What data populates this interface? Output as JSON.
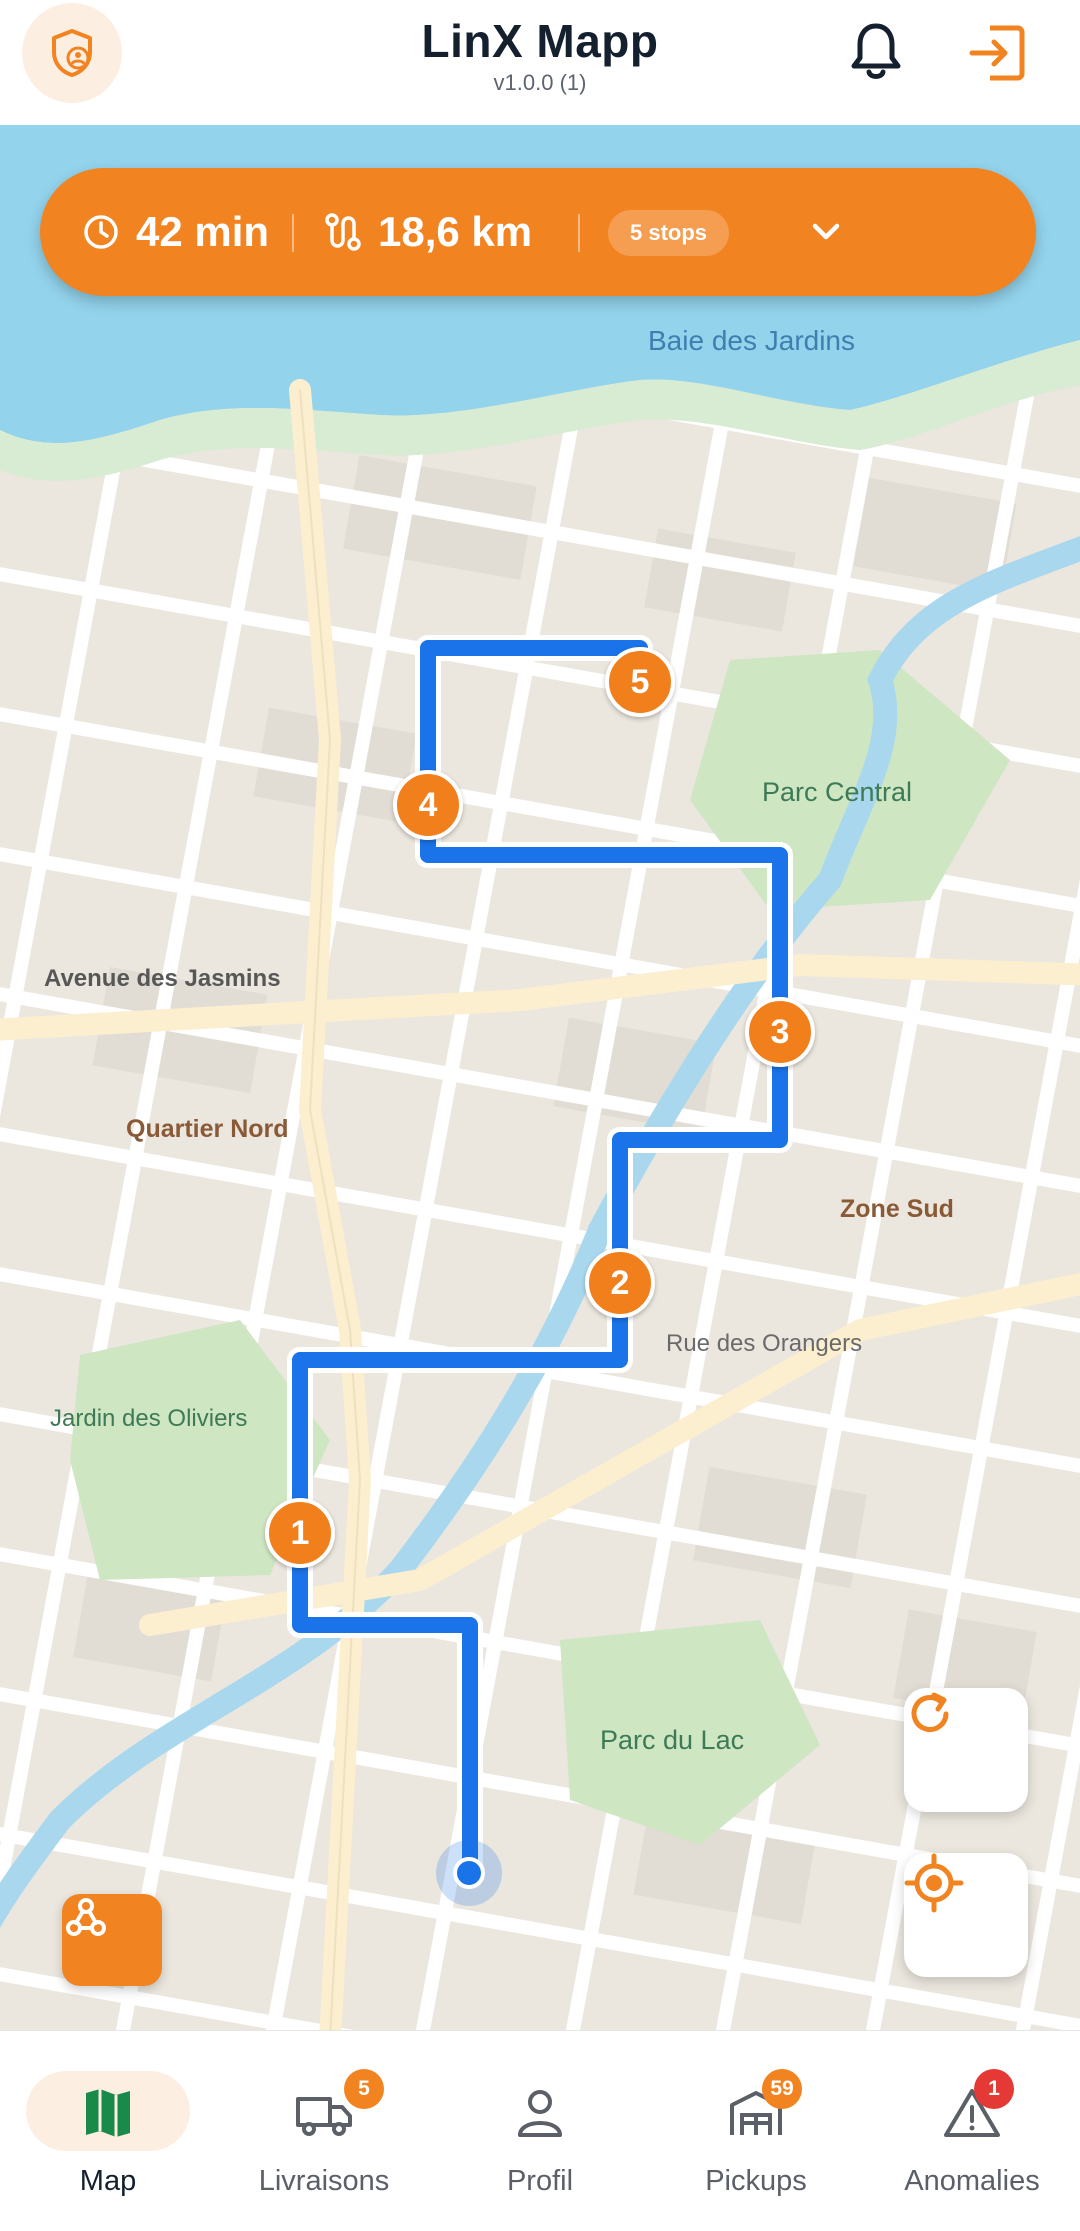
{
  "header": {
    "title": "LinX Mapp",
    "version": "v1.0.0 (1)",
    "left_icon": "shield-user-icon",
    "notification_icon": "bell-icon",
    "logout_icon": "logout-icon"
  },
  "route_summary": {
    "duration": "42 min",
    "distance": "18,6 km",
    "stops": "5 stops"
  },
  "map": {
    "labels": {
      "bay": "Baie des Jardins",
      "park_central": "Parc Central",
      "avenue_jasmins": "Avenue des Jasmins",
      "quartier_nord": "Quartier Nord",
      "zone_sud": "Zone Sud",
      "rue_orangers": "Rue des Orangers",
      "jardin_oliviers": "Jardin des Oliviers",
      "parc_lac": "Parc du Lac"
    },
    "markers": [
      "1",
      "2",
      "3",
      "4",
      "5"
    ]
  },
  "bottom_nav": {
    "items": [
      {
        "label": "Map",
        "icon": "map-icon",
        "active": true
      },
      {
        "label": "Livraisons",
        "icon": "truck-icon",
        "badge": "5"
      },
      {
        "label": "Profil",
        "icon": "user-icon"
      },
      {
        "label": "Pickups",
        "icon": "warehouse-icon",
        "badge": "59"
      },
      {
        "label": "Anomalies",
        "icon": "warning-icon",
        "badge": "1"
      }
    ]
  },
  "colors": {
    "accent": "#f28321",
    "route": "#1a73e8",
    "danger": "#e53935"
  }
}
